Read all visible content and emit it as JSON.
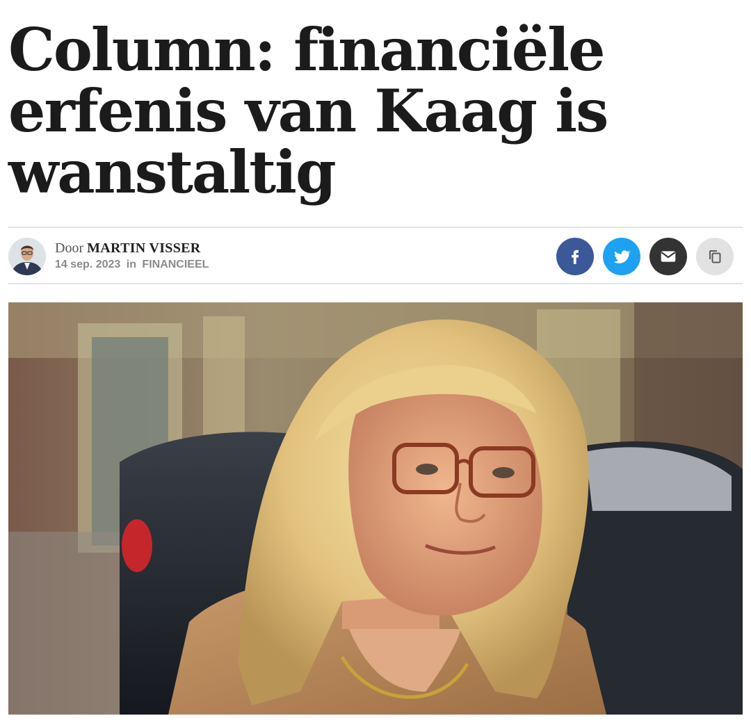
{
  "article": {
    "title": "Column: financiële erfenis van Kaag is wanstaltig"
  },
  "byline": {
    "prefix": "Door",
    "author": "MARTIN VISSER",
    "date": "14 sep. 2023",
    "in_label": "in",
    "category": "FINANCIEEL"
  },
  "share": {
    "icons": [
      "facebook-icon",
      "twitter-icon",
      "email-icon",
      "copy-icon"
    ],
    "colors": {
      "facebook": "#3b5998",
      "twitter": "#1da1f2",
      "email": "#333333",
      "copy": "#e2e2e2"
    }
  },
  "hero_image": {
    "subject": "portrait-photo"
  }
}
